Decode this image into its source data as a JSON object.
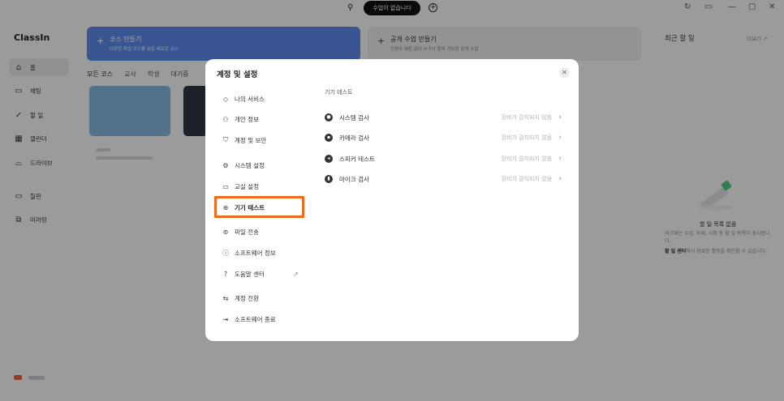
{
  "topbar": {
    "pill_label": "수업이 없습니다",
    "refresh_icon": "refresh-icon",
    "search_icon": "search-icon"
  },
  "app": {
    "logo": "ClassIn"
  },
  "sidebar": {
    "items": [
      {
        "label": "홈",
        "icon": "home-icon"
      },
      {
        "label": "채팅",
        "icon": "chat-icon"
      },
      {
        "label": "할 일",
        "icon": "check-icon"
      },
      {
        "label": "캘린더",
        "icon": "calendar-icon"
      },
      {
        "label": "드라이브",
        "icon": "drive-icon"
      },
      {
        "label": "칠판",
        "icon": "board-icon"
      },
      {
        "label": "미러링",
        "icon": "mirror-icon"
      }
    ]
  },
  "main": {
    "create_course": {
      "title": "코스 만들기",
      "subtitle": "다양한 학습 모드를 갖춘 새로운 코스"
    },
    "public_class": {
      "title": "공개 수업 만들기",
      "subtitle": "인원수 제한 없이 누구나 참여 가능한 공개 수업"
    },
    "tabs": [
      "모든 코스",
      "교사",
      "학생",
      "대기중"
    ]
  },
  "right_panel": {
    "title": "최근 할 일",
    "more": "더보기 ↗",
    "empty_title": "할 일 목록 없음",
    "empty_desc1": "여기에는 수업, 숙제, 시험 등 할 일 목록이 표시됩니다.",
    "empty_desc2_bold": "할 일 센터",
    "empty_desc2": "에서 완료된 활동을 확인할 수 있습니다."
  },
  "modal": {
    "title": "계정 및 설정",
    "close_icon": "close-icon",
    "menu": [
      {
        "label": "나의 서비스",
        "icon": "diamond-icon"
      },
      {
        "label": "개인 정보",
        "icon": "user-icon"
      },
      {
        "label": "계정 및 보안",
        "icon": "shield-icon"
      },
      {
        "label": "시스템 설정",
        "icon": "gear-icon"
      },
      {
        "label": "교실 설정",
        "icon": "monitor-icon"
      },
      {
        "label": "기기 테스트",
        "icon": "device-test-icon"
      },
      {
        "label": "파일 전송",
        "icon": "transfer-icon"
      },
      {
        "label": "소프트웨어 정보",
        "icon": "info-icon"
      },
      {
        "label": "도움말 센터",
        "icon": "help-icon"
      },
      {
        "label": "계정 전환",
        "icon": "switch-icon"
      },
      {
        "label": "소프트웨어 종료",
        "icon": "exit-icon"
      }
    ],
    "section_title": "기기 테스트",
    "devices": [
      {
        "label": "시스템 검사",
        "status": "장비가 감지되지 않음",
        "icon": "system-check-icon"
      },
      {
        "label": "카메라 검사",
        "status": "장비가 감지되지 않음",
        "icon": "camera-icon"
      },
      {
        "label": "스피커 테스트",
        "status": "장비가 감지되지 않음",
        "icon": "speaker-icon"
      },
      {
        "label": "마이크 검사",
        "status": "장비가 감지되지 않음",
        "icon": "mic-icon"
      }
    ]
  },
  "colors": {
    "accent": "#f26b1d",
    "brand_blue": "#5a86e4"
  }
}
